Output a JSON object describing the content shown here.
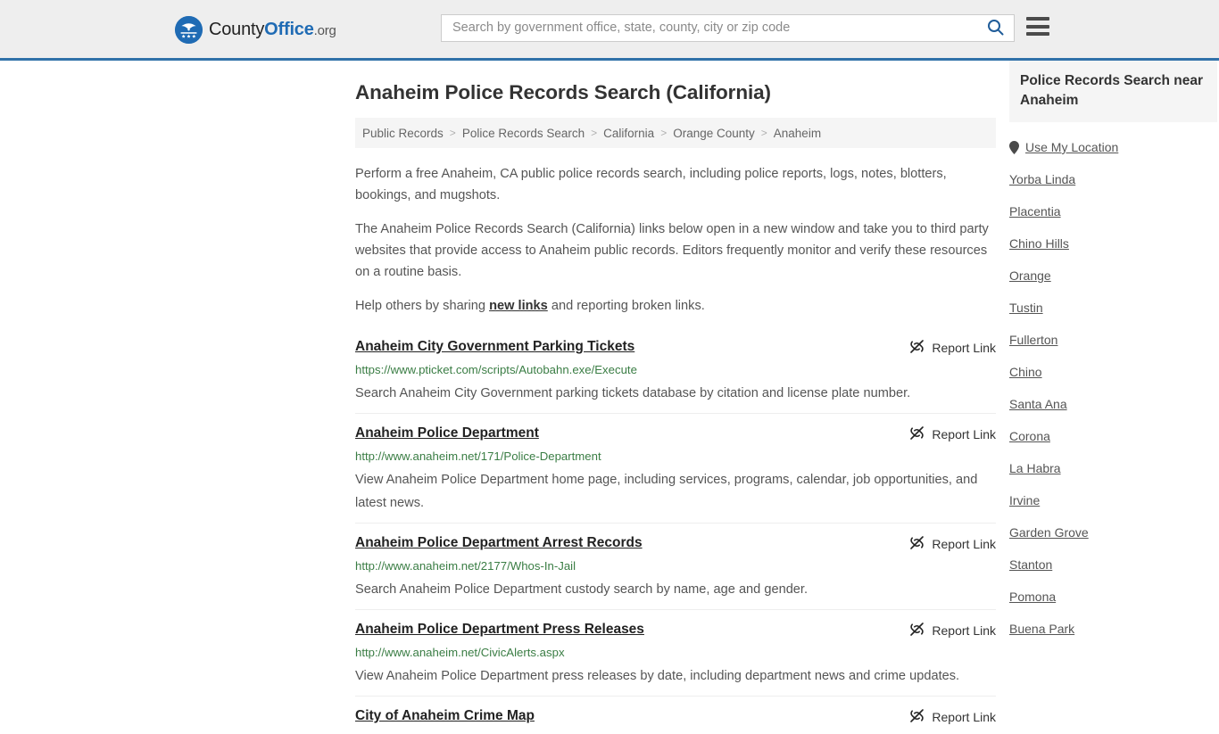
{
  "header": {
    "logo": {
      "text_part1": "County",
      "text_part2": "Office",
      "text_part3": ".org",
      "icon": "eagle-seal-icon"
    },
    "search": {
      "placeholder": "Search by government office, state, county, city or zip code",
      "value": "",
      "icon": "search-icon"
    },
    "menu_icon": "hamburger-menu-icon",
    "accent_color": "#3071a9"
  },
  "main": {
    "title": "Anaheim Police Records Search (California)",
    "breadcrumb": [
      {
        "label": "Public Records",
        "current": false
      },
      {
        "label": "Police Records Search",
        "current": false
      },
      {
        "label": "California",
        "current": false
      },
      {
        "label": "Orange County",
        "current": false
      },
      {
        "label": "Anaheim",
        "current": true
      }
    ],
    "breadcrumb_separator": ">",
    "intro": {
      "p1": "Perform a free Anaheim, CA public police records search, including police reports, logs, notes, blotters, bookings, and mugshots.",
      "p2": "The Anaheim Police Records Search (California) links below open in a new window and take you to third party websites that provide access to Anaheim public records. Editors frequently monitor and verify these resources on a routine basis.",
      "p3_before": "Help others by sharing ",
      "p3_link": "new links",
      "p3_after": " and reporting broken links."
    },
    "report_link_label": "Report Link",
    "report_link_icon": "broken-link-icon",
    "results": [
      {
        "title": "Anaheim City Government Parking Tickets",
        "url": "https://www.pticket.com/scripts/Autobahn.exe/Execute",
        "description": "Search Anaheim City Government parking tickets database by citation and license plate number."
      },
      {
        "title": "Anaheim Police Department",
        "url": "http://www.anaheim.net/171/Police-Department",
        "description": "View Anaheim Police Department home page, including services, programs, calendar, job opportunities, and latest news."
      },
      {
        "title": "Anaheim Police Department Arrest Records",
        "url": "http://www.anaheim.net/2177/Whos-In-Jail",
        "description": "Search Anaheim Police Department custody search by name, age and gender."
      },
      {
        "title": "Anaheim Police Department Press Releases",
        "url": "http://www.anaheim.net/CivicAlerts.aspx",
        "description": "View Anaheim Police Department press releases by date, including department news and crime updates."
      },
      {
        "title": "City of Anaheim Crime Map",
        "url": "",
        "description": ""
      }
    ]
  },
  "sidebar": {
    "title": "Police Records Search near Anaheim",
    "use_my_location": {
      "label": "Use My Location",
      "icon": "map-pin-icon"
    },
    "nearby": [
      "Yorba Linda",
      "Placentia",
      "Chino Hills",
      "Orange",
      "Tustin",
      "Fullerton",
      "Chino",
      "Santa Ana",
      "Corona",
      "La Habra",
      "Irvine",
      "Garden Grove",
      "Stanton",
      "Pomona",
      "Buena Park"
    ]
  }
}
